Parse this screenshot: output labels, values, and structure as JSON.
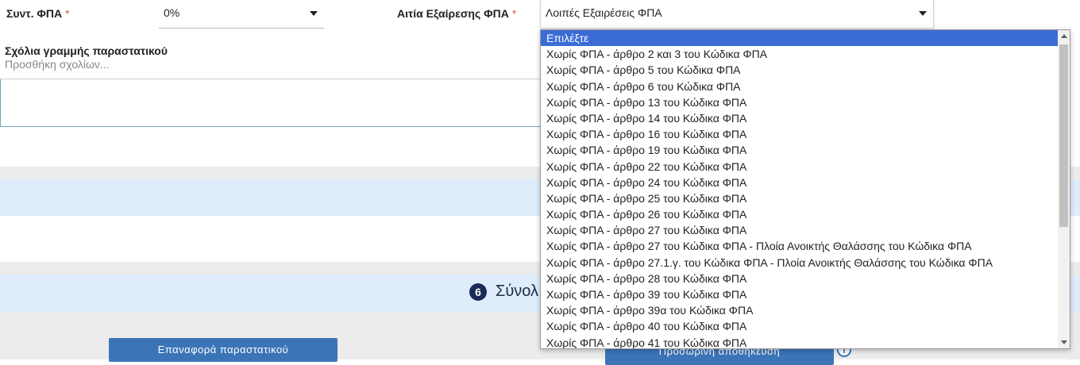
{
  "vat_rate": {
    "label": "Συντ. ΦΠΑ",
    "required_mark": "*",
    "value": "0%"
  },
  "vat_exemption": {
    "label": "Αιτία Εξαίρεσης ΦΠΑ",
    "required_mark": "*",
    "value": "Λοιπές Εξαιρέσεις ΦΠΑ"
  },
  "comments": {
    "label": "Σχόλια γραμμής παραστατικού",
    "placeholder": "Προσθήκη σχολίων..."
  },
  "section": {
    "step_number": "6",
    "title": "Σύνολ"
  },
  "buttons": {
    "reset": "Επαναφορά παραστατικού",
    "save_draft": "Προσωρινή αποθήκευση"
  },
  "dropdown": {
    "selected_index": 0,
    "options": [
      "Επιλέξτε",
      "Χωρίς ΦΠΑ - άρθρο 2 και 3 του Κώδικα ΦΠΑ",
      "Χωρίς ΦΠΑ - άρθρο 5 του Κώδικα ΦΠΑ",
      "Χωρίς ΦΠΑ - άρθρο 6 του Κώδικα ΦΠΑ",
      "Χωρίς ΦΠΑ - άρθρο 13 του Κώδικα ΦΠΑ",
      "Χωρίς ΦΠΑ - άρθρο 14 του Κώδικα ΦΠΑ",
      "Χωρίς ΦΠΑ - άρθρο 16 του Κώδικα ΦΠΑ",
      "Χωρίς ΦΠΑ - άρθρο 19 του Κώδικα ΦΠΑ",
      "Χωρίς ΦΠΑ - άρθρο 22 του Κώδικα ΦΠΑ",
      "Χωρίς ΦΠΑ - άρθρο 24 του Κώδικα ΦΠΑ",
      "Χωρίς ΦΠΑ - άρθρο 25 του Κώδικα ΦΠΑ",
      "Χωρίς ΦΠΑ - άρθρο 26 του Κώδικα ΦΠΑ",
      "Χωρίς ΦΠΑ - άρθρο 27 του Κώδικα ΦΠΑ",
      "Χωρίς ΦΠΑ - άρθρο 27 του Κώδικα ΦΠΑ - Πλοία Ανοικτής Θαλάσσης του Κώδικα ΦΠΑ",
      "Χωρίς ΦΠΑ - άρθρο 27.1.γ. του Κώδικα ΦΠΑ - Πλοία Ανοικτής Θαλάσσης του Κώδικα ΦΠΑ",
      "Χωρίς ΦΠΑ - άρθρο 28 του Κώδικα ΦΠΑ",
      "Χωρίς ΦΠΑ - άρθρο 39 του Κώδικα ΦΠΑ",
      "Χωρίς ΦΠΑ - άρθρο 39α του Κώδικα ΦΠΑ",
      "Χωρίς ΦΠΑ - άρθρο 40 του Κώδικα ΦΠΑ",
      "Χωρίς ΦΠΑ - άρθρο 41 του Κώδικα ΦΠΑ"
    ]
  },
  "icons": {
    "info": "info-icon",
    "dropdown_arrow": "chevron-down-icon"
  }
}
